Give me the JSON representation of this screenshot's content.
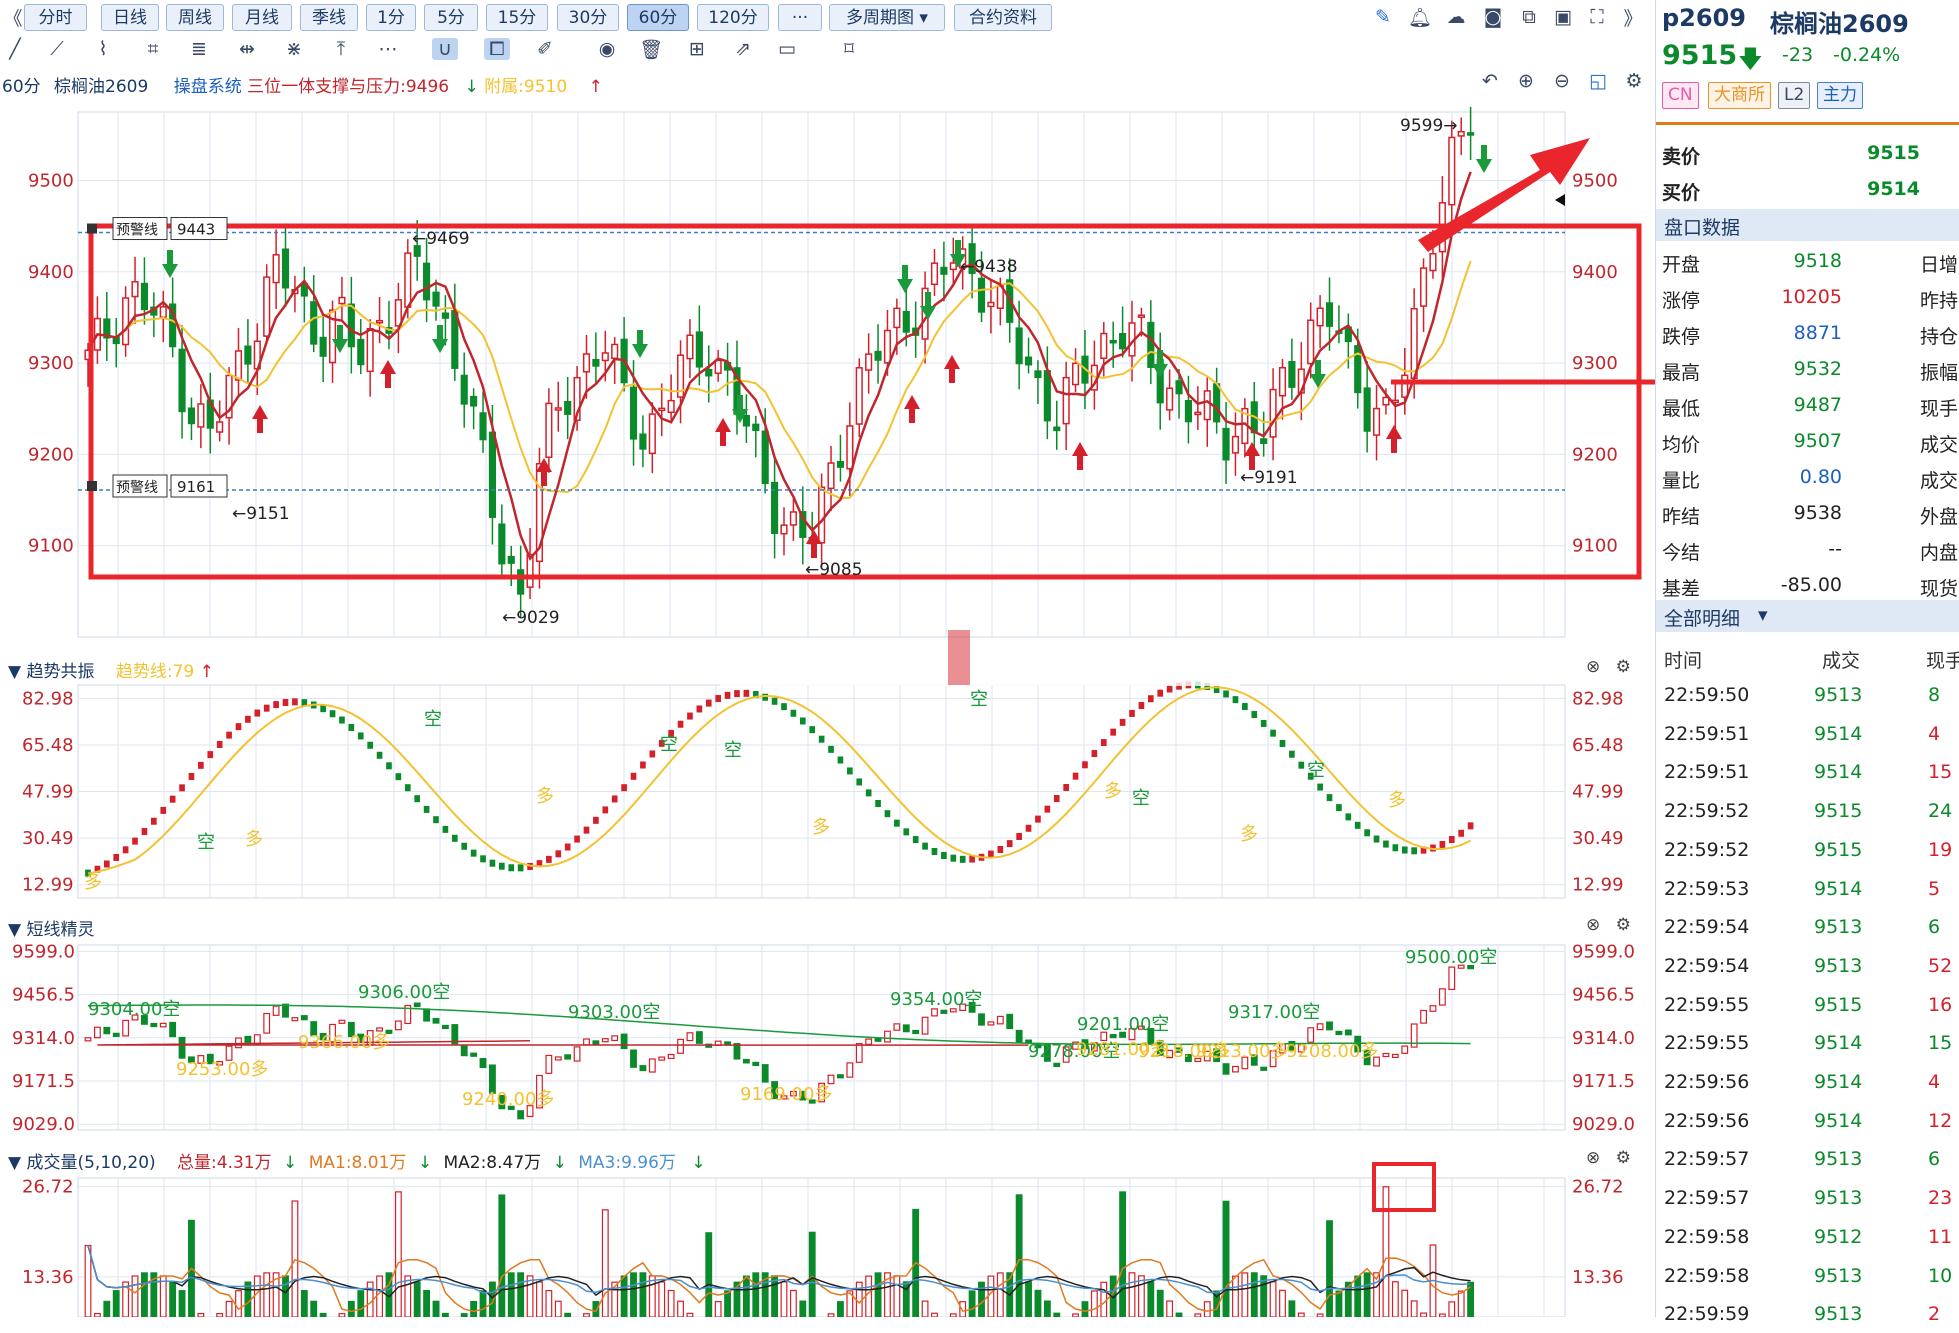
{
  "toolbar": {
    "collapse_left": "《",
    "periods": [
      "分时",
      "日线",
      "周线",
      "月线",
      "季线",
      "1分",
      "5分",
      "15分",
      "30分",
      "60分",
      "120分"
    ],
    "active_period": "60分",
    "more": "···",
    "multi_period": "多周期图",
    "contract_info": "合约资料",
    "expand_right": "》"
  },
  "main": {
    "period_label": "60分",
    "symbol_label": "棕榈油2609",
    "system_label": "操盘系统",
    "indicator_label": "三位一体支撑与压力:9496",
    "attach_label": "附属:9510",
    "y_ticks": [
      "9500",
      "9400",
      "9300",
      "9200",
      "9100"
    ],
    "warn_label": "预警线",
    "warn_upper": "9443",
    "warn_lower": "9161",
    "annotations": [
      "9599",
      "9469",
      "9438",
      "9151",
      "9191",
      "9085",
      "9029"
    ]
  },
  "pane2": {
    "title": "趋势共振",
    "trend_label": "趋势线:79",
    "y_ticks": [
      "82.98",
      "65.48",
      "47.99",
      "30.49",
      "12.99"
    ],
    "marks_duo": "多",
    "marks_kong": "空"
  },
  "pane3": {
    "title": "短线精灵",
    "y_ticks": [
      "9599.0",
      "9456.5",
      "9314.0",
      "9171.5",
      "9029.0"
    ],
    "labels": [
      "9304.00空",
      "9306.00空",
      "9303.00空",
      "9354.00空",
      "9201.00空",
      "9317.00空",
      "9500.00空",
      "9278.00空",
      "9253.00多",
      "9366.00多",
      "9240.00多",
      "9169.00多",
      "9281.00多",
      "9218.00多",
      "9213.00多",
      "9208.00多"
    ]
  },
  "pane4": {
    "title": "成交量(5,10,20)",
    "total": "总量:4.31万",
    "ma1": "MA1:8.01万",
    "ma2": "MA2:8.47万",
    "ma3": "MA3:9.96万",
    "y_ticks": [
      "26.72",
      "13.36"
    ]
  },
  "quote": {
    "code": "p2609",
    "name": "棕榈油2609",
    "price": "9515",
    "change": "-23",
    "change_pct": "-0.24%",
    "badges": [
      "CN",
      "大商所",
      "L2",
      "主力"
    ],
    "sell_label": "卖价",
    "sell_value": "9515",
    "buy_label": "买价",
    "buy_value": "9514",
    "section_title": "盘口数据",
    "rows": [
      {
        "label": "开盘",
        "value": "9518",
        "label2": "日增"
      },
      {
        "label": "涨停",
        "value": "10205",
        "label2": "昨持"
      },
      {
        "label": "跌停",
        "value": "8871",
        "label2": "持仓"
      },
      {
        "label": "最高",
        "value": "9532",
        "label2": "振幅"
      },
      {
        "label": "最低",
        "value": "9487",
        "label2": "现手"
      },
      {
        "label": "均价",
        "value": "9507",
        "label2": "成交"
      },
      {
        "label": "量比",
        "value": "0.80",
        "label2": "成交"
      },
      {
        "label": "昨结",
        "value": "9538",
        "label2": "外盘"
      },
      {
        "label": "今结",
        "value": "--",
        "label2": "内盘"
      },
      {
        "label": "基差",
        "value": "-85.00",
        "label2": "现货"
      }
    ],
    "detail_title": "全部明细",
    "detail_headers": [
      "时间",
      "成交",
      "现手"
    ],
    "trades": [
      {
        "time": "22:59:50",
        "price": "9513",
        "vol": "8"
      },
      {
        "time": "22:59:51",
        "price": "9514",
        "vol": "4"
      },
      {
        "time": "22:59:51",
        "price": "9514",
        "vol": "15"
      },
      {
        "time": "22:59:52",
        "price": "9515",
        "vol": "24"
      },
      {
        "time": "22:59:52",
        "price": "9515",
        "vol": "19"
      },
      {
        "time": "22:59:53",
        "price": "9514",
        "vol": "5"
      },
      {
        "time": "22:59:54",
        "price": "9513",
        "vol": "6"
      },
      {
        "time": "22:59:54",
        "price": "9513",
        "vol": "52"
      },
      {
        "time": "22:59:55",
        "price": "9515",
        "vol": "16"
      },
      {
        "time": "22:59:55",
        "price": "9514",
        "vol": "15"
      },
      {
        "time": "22:59:56",
        "price": "9514",
        "vol": "4"
      },
      {
        "time": "22:59:56",
        "price": "9514",
        "vol": "12"
      },
      {
        "time": "22:59:57",
        "price": "9513",
        "vol": "6"
      },
      {
        "time": "22:59:57",
        "price": "9513",
        "vol": "23"
      },
      {
        "time": "22:59:58",
        "price": "9512",
        "vol": "11"
      },
      {
        "time": "22:59:58",
        "price": "9513",
        "vol": "10"
      },
      {
        "time": "22:59:59",
        "price": "9513",
        "vol": "2"
      }
    ]
  },
  "colors": {
    "up": "#d4202a",
    "down": "#0a8a2a",
    "ma_red": "#c0272d",
    "ma_yellow": "#f2c230",
    "annot_box": "#e8262b",
    "grid": "#dde5f0",
    "accent": "#1d5fbf"
  },
  "chart_data": {
    "type": "candlestick",
    "series_price_approx": [
      9300,
      9340,
      9380,
      9360,
      9320,
      9250,
      9220,
      9280,
      9340,
      9400,
      9380,
      9330,
      9360,
      9300,
      9340,
      9380,
      9400,
      9360,
      9300,
      9200,
      9100,
      9050,
      9200,
      9260,
      9300,
      9320,
      9260,
      9220,
      9260,
      9300,
      9320,
      9280,
      9220,
      9160,
      9120,
      9100,
      9180,
      9260,
      9300,
      9340,
      9360,
      9380,
      9420,
      9400,
      9360,
      9320,
      9280,
      9240,
      9280,
      9320,
      9340,
      9320,
      9280,
      9260,
      9240,
      9220,
      9240,
      9220,
      9280,
      9330,
      9360,
      9300,
      9260,
      9240,
      9300,
      9440,
      9520,
      9560
    ]
  }
}
